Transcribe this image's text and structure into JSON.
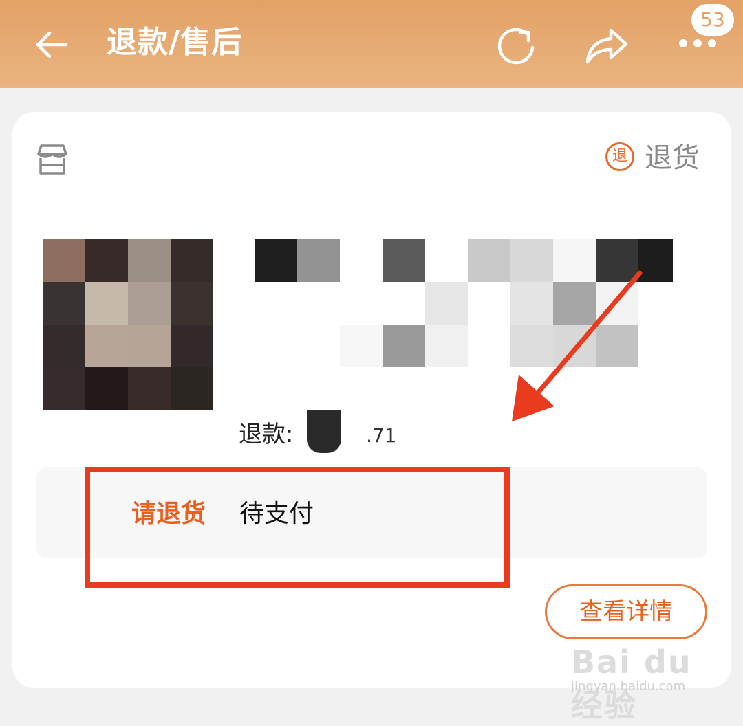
{
  "header": {
    "title": "退款/售后",
    "back_icon": "arrow-left-icon",
    "refresh_icon": "refresh-icon",
    "share_icon": "share-icon",
    "more_icon": "more-dots-icon",
    "message_badge": "53",
    "background_color": "#e5a86d"
  },
  "order": {
    "store_icon": "store-icon",
    "return_tag_glyph": "退",
    "return_type": "退货",
    "refund_label": "退款:",
    "refund_amount_suffix": ".71",
    "status_action": "请退货",
    "status_text": "待支付",
    "detail_button": "查看详情",
    "accent_color": "#e8611e"
  },
  "annotations": {
    "highlight_color": "#ea3b1f"
  },
  "watermark": {
    "line1": "Bai du 经验",
    "line2": "jingyan.baidu.com"
  }
}
